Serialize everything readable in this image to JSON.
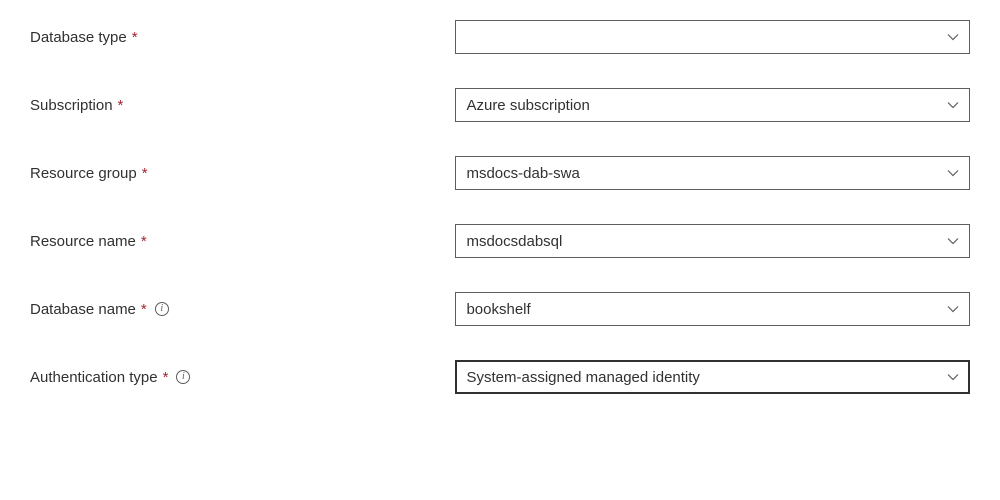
{
  "form": {
    "fields": [
      {
        "label": "Database type",
        "required": true,
        "info": false,
        "value": "",
        "name": "database-type",
        "focused": false
      },
      {
        "label": "Subscription",
        "required": true,
        "info": false,
        "value": "Azure subscription",
        "name": "subscription",
        "focused": false
      },
      {
        "label": "Resource group",
        "required": true,
        "info": false,
        "value": "msdocs-dab-swa",
        "name": "resource-group",
        "focused": false
      },
      {
        "label": "Resource name",
        "required": true,
        "info": false,
        "value": "msdocsdabsql",
        "name": "resource-name",
        "focused": false
      },
      {
        "label": "Database name",
        "required": true,
        "info": true,
        "value": "bookshelf",
        "name": "database-name",
        "focused": false
      },
      {
        "label": "Authentication type",
        "required": true,
        "info": true,
        "value": "System-assigned managed identity",
        "name": "authentication-type",
        "focused": true
      }
    ],
    "required_marker": "*",
    "info_marker": "i"
  }
}
